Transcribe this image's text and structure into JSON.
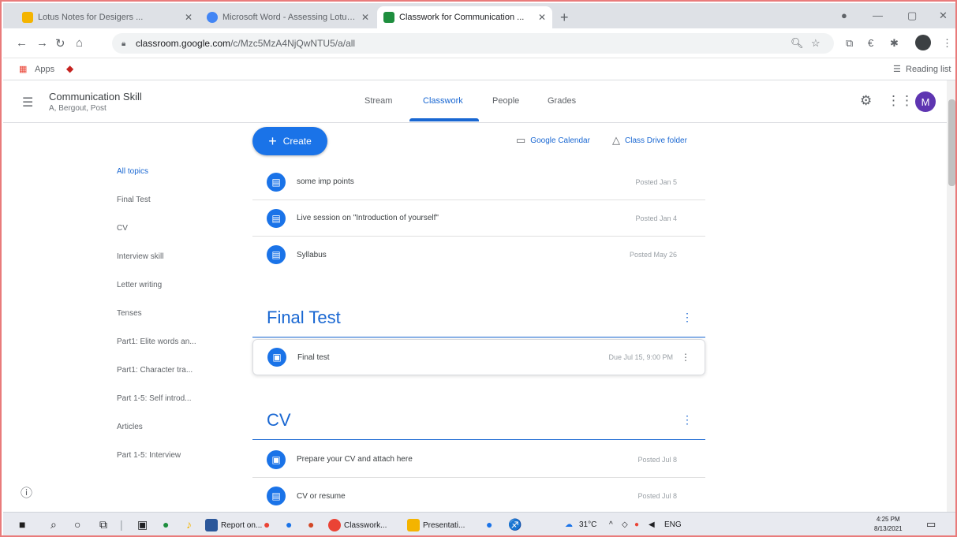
{
  "browser": {
    "tabs": [
      {
        "title": "Lotus Notes for Desigers ...",
        "color": "#f4b400"
      },
      {
        "title": "Microsoft Word - Assessing Lotus ...",
        "color": "#4285f4"
      },
      {
        "title": "Classwork for Communication ...",
        "color": "#1e8e3e"
      }
    ],
    "new_tab": "+",
    "url_host": "classroom.google.com",
    "url_path": "/c/Mzc5MzA4NjQwNTU5/a/all",
    "bookmarks_apps": "Apps",
    "reading_list": "Reading list"
  },
  "classroom": {
    "course_name": "Communication Skill",
    "section": "A, Bergout, Post",
    "tabs": [
      "Stream",
      "Classwork",
      "People",
      "Grades"
    ],
    "active_tab": "Classwork",
    "avatar": "M",
    "create_label": "Create",
    "calendar_link": "Google Calendar",
    "drive_link": "Class Drive folder",
    "topics_nav": [
      "All topics",
      "Final Test",
      "CV",
      "Interview skill",
      "Letter writing",
      "Tenses",
      "Part1: Elite words an...",
      "Part1: Character tra...",
      "Part 1-5: Self introd...",
      "Articles",
      "Part 1-5: Interview"
    ],
    "items": [
      {
        "title": "some imp points",
        "date": "Posted Jan 5"
      },
      {
        "title": "Live session on \"Introduction of yourself\"",
        "date": "Posted Jan 4"
      },
      {
        "title": "Syllabus",
        "date": "Posted May 26"
      }
    ],
    "topic_final": {
      "name": "Final Test",
      "items": [
        {
          "title": "Final test",
          "date": "Due Jul 15, 9:00 PM"
        }
      ]
    },
    "topic_cv": {
      "name": "CV",
      "items": [
        {
          "title": "Prepare your CV and attach here",
          "date": "Posted Jul 8"
        },
        {
          "title": "CV or resume",
          "date": "Posted Jul 8"
        }
      ]
    }
  },
  "taskbar": {
    "apps": [
      {
        "label": "Report on...",
        "color": "#2b579a"
      },
      {
        "label": "Classwork...",
        "color": "#ea4335"
      },
      {
        "label": "Presentati...",
        "color": "#f4b400"
      }
    ],
    "weather": "31°C",
    "lang": "ENG",
    "time": "4:25 PM",
    "date": "8/13/2021"
  }
}
